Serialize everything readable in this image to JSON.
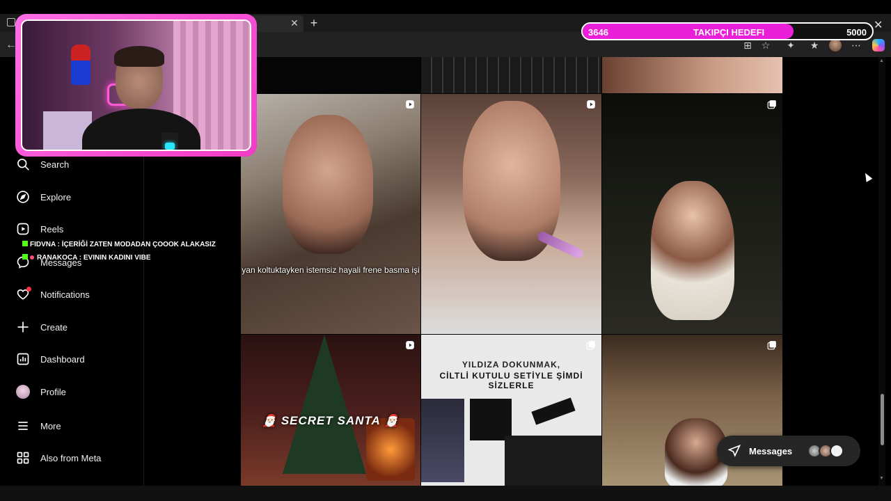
{
  "goal": {
    "current": "3646",
    "label": "TAKIPÇI HEDEFI",
    "target": "5000",
    "progress_fraction": 0.729,
    "fill_color": "#e91fd9"
  },
  "nav": {
    "items": [
      {
        "label": "Search",
        "icon": "search-icon"
      },
      {
        "label": "Explore",
        "icon": "compass-icon"
      },
      {
        "label": "Reels",
        "icon": "reels-icon"
      },
      {
        "label": "Messages",
        "icon": "messenger-icon"
      },
      {
        "label": "Notifications",
        "icon": "heart-icon"
      },
      {
        "label": "Create",
        "icon": "plus-icon"
      },
      {
        "label": "Dashboard",
        "icon": "dashboard-icon"
      },
      {
        "label": "Profile",
        "icon": "avatar"
      },
      {
        "label": "More",
        "icon": "hamburger-icon"
      },
      {
        "label": "Also from Meta",
        "icon": "meta-grid-icon"
      }
    ]
  },
  "chat": [
    {
      "user": "FIDVNA",
      "message": "İÇERİĞİ ZATEN MODADAN ÇOOOK ALAKASIZ"
    },
    {
      "user": "RANAKOCA",
      "message": "EVININ KADINI VIBE"
    }
  ],
  "feed": {
    "captions": {
      "tile_car": "yan koltuktayken istemsiz hayali frene basma işi",
      "tile_santa": "🎅🏻 SECRET SANTA 🎅🏻",
      "tile_promo_line1": "YILDIZA DOKUNMAK,",
      "tile_promo_line2": "CİLTLİ KUTULU SETİYLE ŞİMDİ SİZLERLE"
    }
  },
  "messages_pill": {
    "label": "Messages"
  },
  "colors": {
    "accent": "#ff2ec8",
    "notification_dot": "#ff3040"
  }
}
